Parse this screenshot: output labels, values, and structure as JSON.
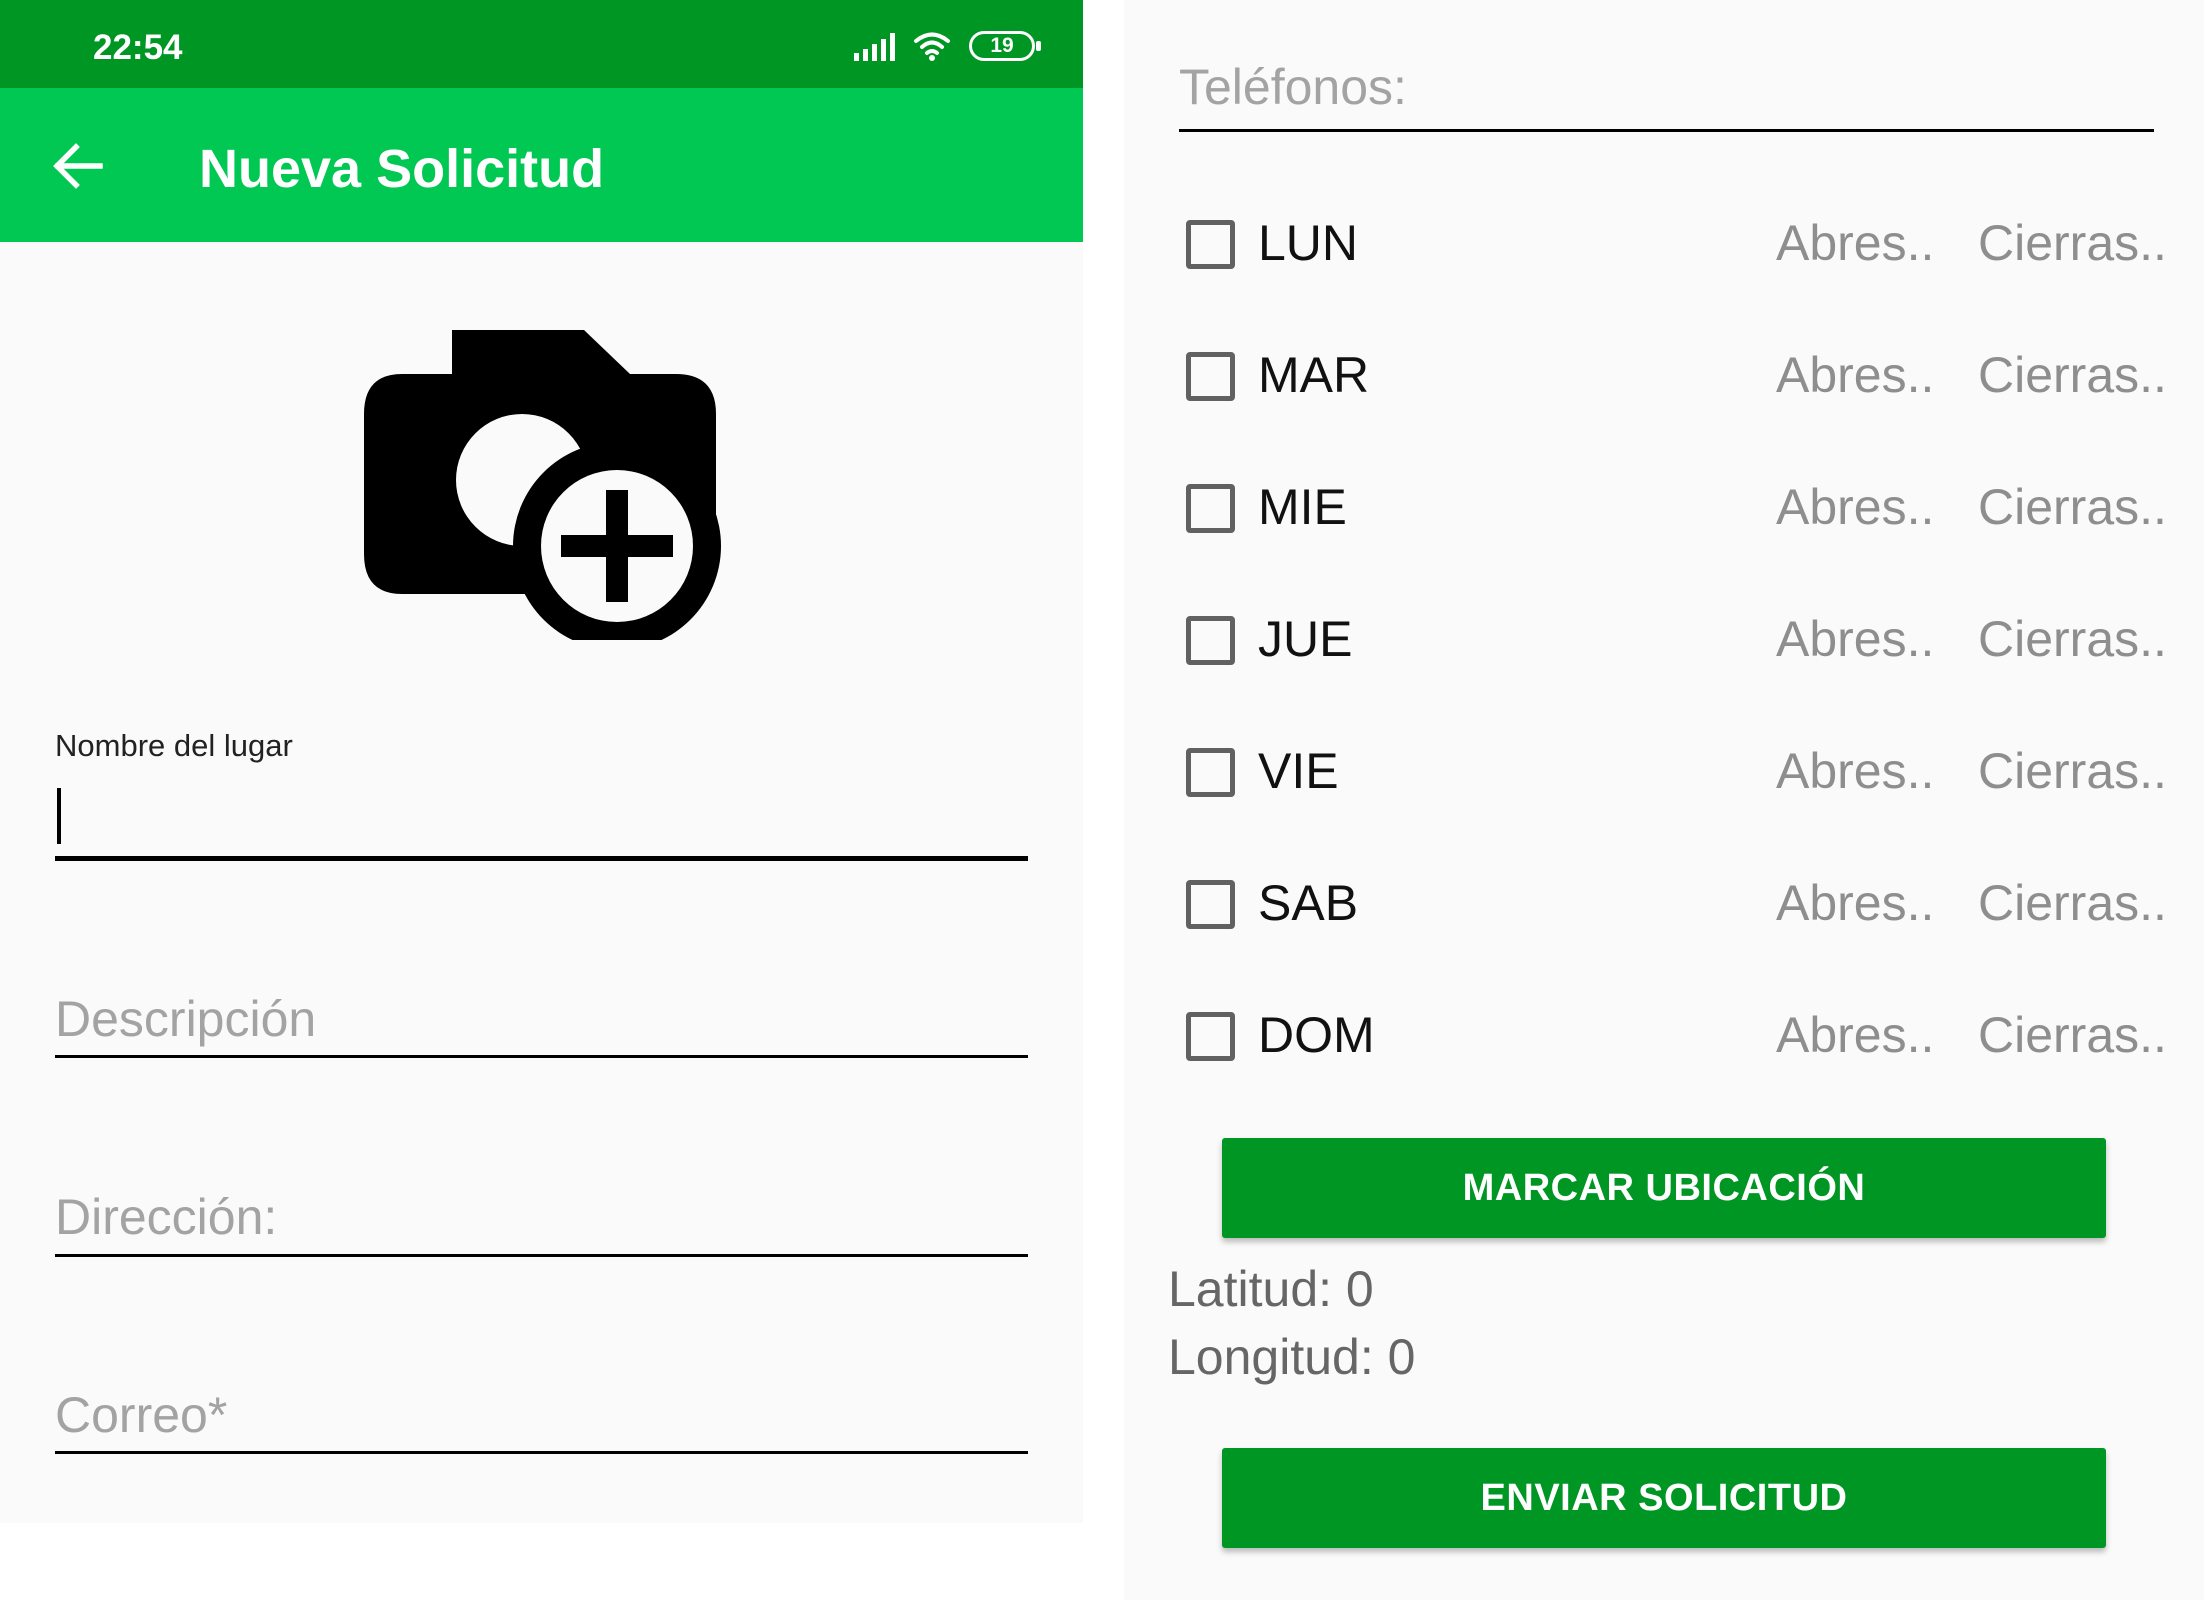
{
  "status_bar": {
    "time": "22:54",
    "battery": "19"
  },
  "app_bar": {
    "title": "Nueva Solicitud"
  },
  "form": {
    "nombre_label": "Nombre del lugar",
    "nombre_value": "",
    "descripcion_placeholder": "Descripción",
    "direccion_placeholder": "Dirección:",
    "correo_placeholder": "Correo*",
    "telefonos_placeholder": "Teléfonos:"
  },
  "schedule": {
    "days": [
      {
        "label": "LUN",
        "open": "Abres..",
        "close": "Cierras..",
        "checked": false
      },
      {
        "label": "MAR",
        "open": "Abres..",
        "close": "Cierras..",
        "checked": false
      },
      {
        "label": "MIE",
        "open": "Abres..",
        "close": "Cierras..",
        "checked": false
      },
      {
        "label": "JUE",
        "open": "Abres..",
        "close": "Cierras..",
        "checked": false
      },
      {
        "label": "VIE",
        "open": "Abres..",
        "close": "Cierras..",
        "checked": false
      },
      {
        "label": "SAB",
        "open": "Abres..",
        "close": "Cierras..",
        "checked": false
      },
      {
        "label": "DOM",
        "open": "Abres..",
        "close": "Cierras..",
        "checked": false
      }
    ]
  },
  "location": {
    "button_label": "MARCAR UBICACIÓN",
    "latitude": "Latitud: 0",
    "longitude": "Longitud: 0"
  },
  "submit": {
    "button_label": "ENVIAR SOLICITUD"
  },
  "colors": {
    "status_bar": "#009624",
    "app_bar": "#00c853",
    "button": "#009624"
  },
  "icons": [
    "arrow-back-icon",
    "add-photo-camera-icon",
    "signal-icon",
    "wifi-icon",
    "battery-icon"
  ]
}
